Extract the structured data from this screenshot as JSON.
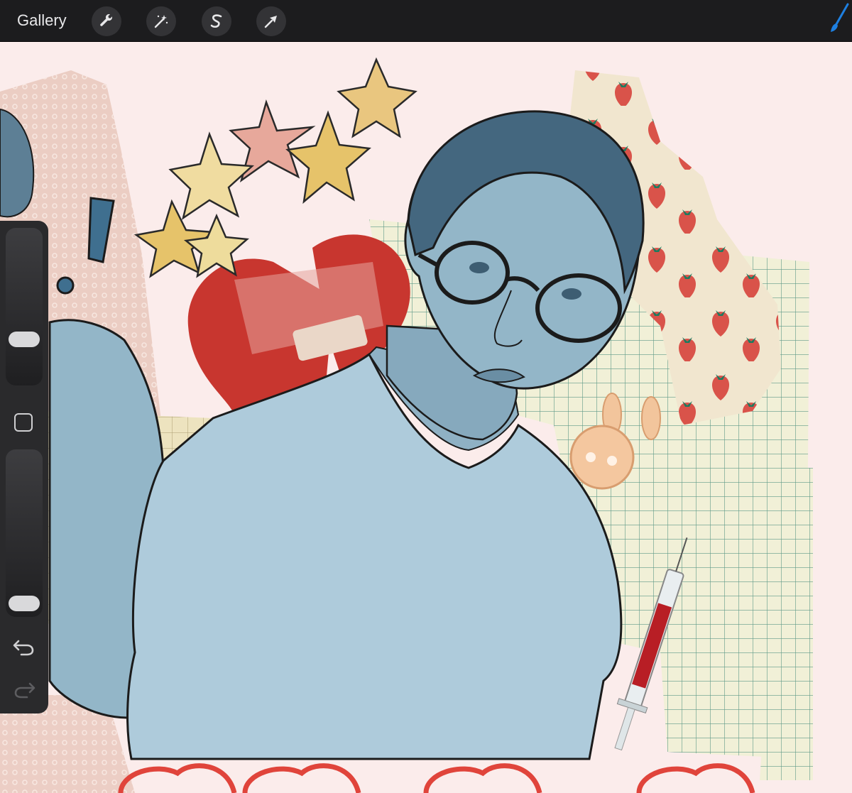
{
  "toolbar": {
    "gallery_label": "Gallery",
    "tools": [
      {
        "name": "actions",
        "icon": "wrench-icon"
      },
      {
        "name": "adjustments",
        "icon": "magic-wand-icon"
      },
      {
        "name": "selection",
        "icon": "selection-s-icon"
      },
      {
        "name": "transform",
        "icon": "arrow-cursor-icon"
      }
    ],
    "brush_icon": "brush-icon",
    "brush_color": "#1e7fe0"
  },
  "sidebar": {
    "brush_size_level": 0.26,
    "opacity_level": 0.02,
    "modify_icon": "square-modify-icon",
    "undo_icon": "undo-icon",
    "redo_icon": "redo-icon"
  },
  "colors": {
    "toolbar_bg": "#1c1c1e",
    "canvas_bg": "#fbeceb",
    "figure_blue": "#93b6c8",
    "heart_red": "#c8362f",
    "strawberry_red": "#d9534a",
    "grid_paper": "#f1f0d7"
  }
}
